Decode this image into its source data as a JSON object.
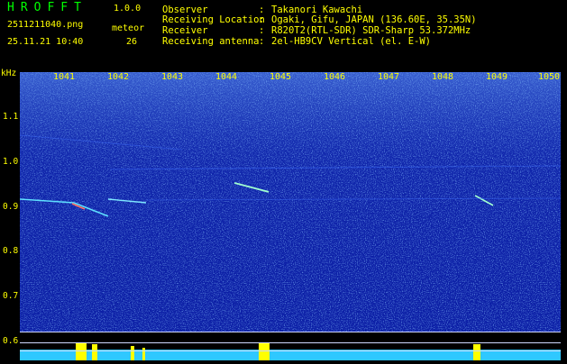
{
  "header": {
    "logo": "HROFFT",
    "version": "1.0.0",
    "filename": "2511211040.png",
    "meteor_label": "meteor",
    "datetime": "25.11.21 10:40",
    "meteor_count": "26",
    "rows": [
      {
        "key": "Observer",
        "value": "Takanori Kawachi"
      },
      {
        "key": "Receiving Location",
        "value": "Ogaki, Gifu, JAPAN (136.60E, 35.35N)"
      },
      {
        "key": "Receiver",
        "value": "R820T2(RTL-SDR) SDR-Sharp 53.372MHz"
      },
      {
        "key": "Receiving antenna",
        "value": "2el-HB9CV Vertical (el. E-W)"
      }
    ]
  },
  "axis": {
    "unit": "kHz",
    "y_ticks": [
      "1.1",
      "1.0",
      "0.9",
      "0.8",
      "0.7",
      "0.6"
    ],
    "x_ticks": [
      "1041",
      "1042",
      "1043",
      "1044",
      "1045",
      "1046",
      "1047",
      "1048",
      "1049",
      "1050"
    ]
  },
  "colors": {
    "background": "#000000",
    "plot": "#0c1fa6",
    "text_yellow": "#ffff00",
    "logo_green": "#00ff00",
    "signal_cyan": "#40e0ff"
  }
}
